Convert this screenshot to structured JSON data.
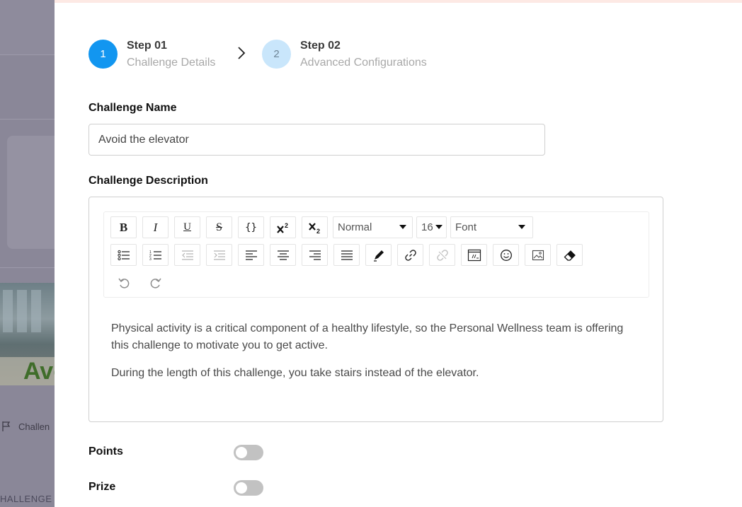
{
  "background": {
    "photo_text": "Avo",
    "challenge_link": "Challen",
    "challenge_header": "HALLENGE"
  },
  "stepper": {
    "steps": [
      {
        "number": "1",
        "title": "Step 01",
        "subtitle": "Challenge Details",
        "status": "active"
      },
      {
        "number": "2",
        "title": "Step 02",
        "subtitle": "Advanced Configurations",
        "status": "upcoming"
      }
    ]
  },
  "form": {
    "name_label": "Challenge Name",
    "name_value": "Avoid the elevator",
    "description_label": "Challenge Description",
    "points_label": "Points",
    "points_enabled": false,
    "prize_label": "Prize",
    "prize_enabled": false
  },
  "editor": {
    "toolbar": {
      "bold": "B",
      "italic": "I",
      "underline": "U",
      "strike": "S",
      "code": "{}",
      "format_value": "Normal",
      "size_value": "16",
      "font_value": "Font"
    },
    "paragraphs": [
      "Physical activity is a critical component of a healthy lifestyle, so the Personal Wellness team is offering this challenge to motivate you to get active.",
      "During the length of this challenge, you take stairs instead of the elevator."
    ]
  },
  "colors": {
    "primary": "#1296f0",
    "step_inactive": "#c9e6fb",
    "overlay": "#8a8798",
    "toggle_off": "#c2c2c2"
  }
}
